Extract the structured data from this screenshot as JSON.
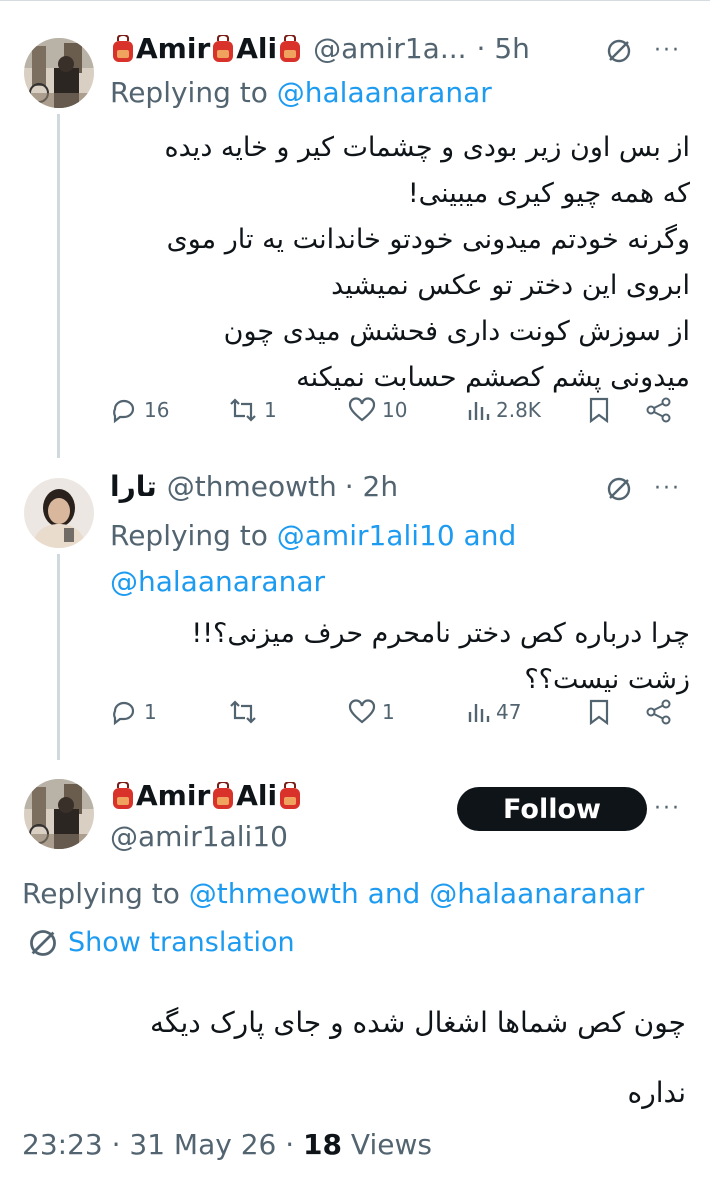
{
  "tweets": [
    {
      "display_name": "Amir",
      "display_name_2": "Ali",
      "handle": "@amir1a...",
      "time": "· 5h",
      "replying_label": "Replying to",
      "replying_to": "@halaanaranar",
      "body_lines": [
        "از بس اون زیر بودی و چشمات کیر و  خایه دیده",
        "که همه چیو کیری میبینی!",
        "وگرنه خودتم میدونی خودتو خاندانت یه تار موی",
        "ابروی این دختر تو عکس نمیشید",
        "از سوزش کونت داری فحشش میدی چون",
        "میدونی پشم کصشم حسابت نمیکنه"
      ],
      "replies": "16",
      "retweets": "1",
      "likes": "10",
      "views": "2.8K"
    },
    {
      "display_name": "تارا",
      "handle": "@thmeowth",
      "time": "· 2h",
      "replying_label": "Replying to",
      "replying_to": "@amir1ali10 and",
      "replying_to_2": "@halaanaranar",
      "body_lines": [
        "چرا درباره کص دختر نامحرم حرف میزنی؟!!",
        "زشت نیست؟؟"
      ],
      "replies": "1",
      "retweets": "",
      "likes": "1",
      "views": "47"
    }
  ],
  "main_tweet": {
    "display_name": "Amir",
    "display_name_2": "Ali",
    "handle": "@amir1ali10",
    "follow_label": "Follow",
    "replying_label": "Replying to",
    "replying_to_1": "@thmeowth",
    "replying_and": "and",
    "replying_to_2": "@halaanaranar",
    "show_translation": "Show translation",
    "body_lines": [
      "چون کص شماها اشغال شده و جای پارک دیگه",
      "نداره"
    ],
    "time": "23:23 · 31 May 26 ·",
    "views_count": "18",
    "views_label": "Views"
  },
  "more_glyph": "···",
  "colors": {
    "accent": "#1d9bf0",
    "text": "#0f1419",
    "muted": "#536471",
    "bag": "#d8322b"
  }
}
